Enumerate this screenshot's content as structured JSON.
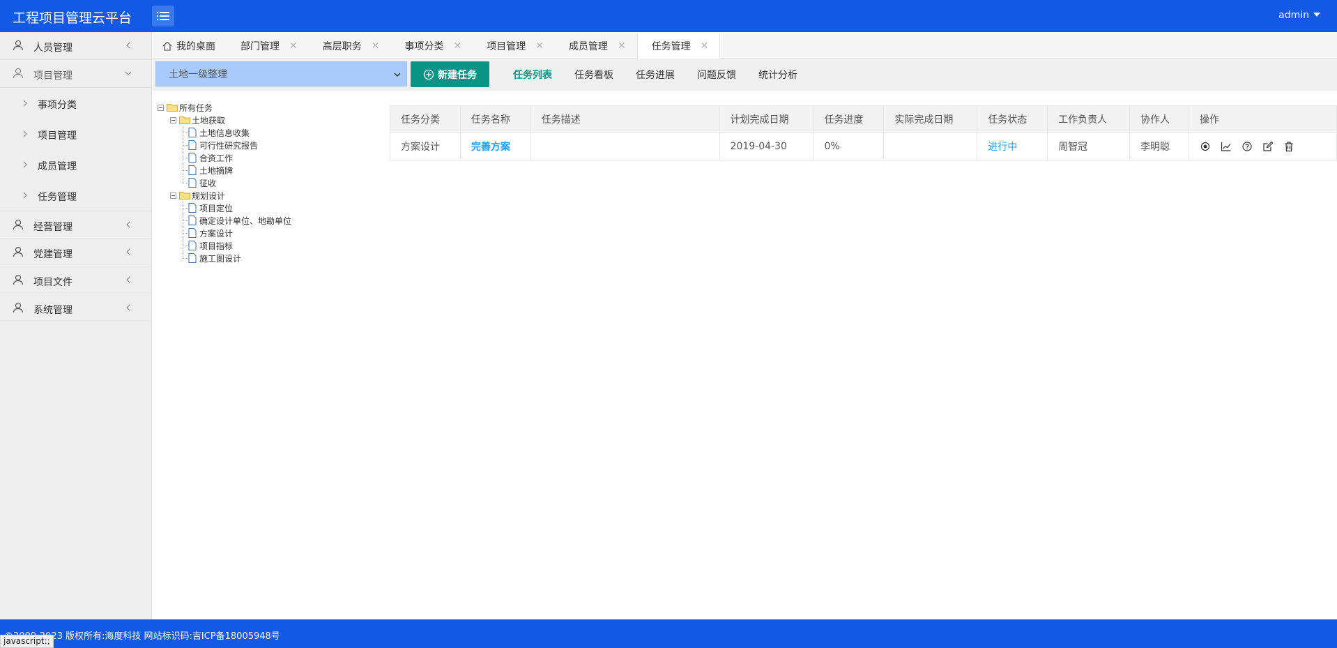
{
  "header": {
    "brand": "工程项目管理云平台",
    "user": "admin"
  },
  "sidebar": {
    "items": [
      {
        "label": "人员管理"
      },
      {
        "label": "项目管理"
      },
      {
        "label": "经营管理"
      },
      {
        "label": "党建管理"
      },
      {
        "label": "项目文件"
      },
      {
        "label": "系统管理"
      }
    ],
    "sub_items": [
      {
        "label": "事项分类"
      },
      {
        "label": "项目管理"
      },
      {
        "label": "成员管理"
      },
      {
        "label": "任务管理"
      }
    ]
  },
  "tabs": [
    {
      "label": "我的桌面"
    },
    {
      "label": "部门管理"
    },
    {
      "label": "高层职务"
    },
    {
      "label": "事项分类"
    },
    {
      "label": "项目管理"
    },
    {
      "label": "成员管理"
    },
    {
      "label": "任务管理"
    }
  ],
  "toolbar": {
    "select_value": "土地一级整理",
    "new_button": "新建任务",
    "subnav": [
      "任务列表",
      "任务看板",
      "任务进展",
      "问题反馈",
      "统计分析"
    ]
  },
  "tree": {
    "root": "所有任务",
    "groups": [
      {
        "label": "土地获取",
        "children": [
          "土地信息收集",
          "可行性研究报告",
          "合资工作",
          "土地摘牌",
          "征收"
        ]
      },
      {
        "label": "规划设计",
        "children": [
          "项目定位",
          "确定设计单位、地勘单位",
          "方案设计",
          "项目指标",
          "施工图设计"
        ]
      }
    ]
  },
  "table": {
    "headers": [
      "任务分类",
      "任务名称",
      "任务描述",
      "计划完成日期",
      "任务进度",
      "实际完成日期",
      "任务状态",
      "工作负责人",
      "协作人",
      "操作"
    ],
    "rows": [
      {
        "category": "方案设计",
        "name": "完善方案",
        "description": "",
        "plan_date": "2019-04-30",
        "progress": "0%",
        "actual_date": "",
        "status": "进行中",
        "owner": "周智冠",
        "collaborator": "李明聪"
      }
    ]
  },
  "footer": {
    "text": "©2009-2023 版权所有:海度科技 网站标识码:吉ICP备18005948号"
  },
  "statusbar": {
    "text": "javascript:;"
  },
  "colors": {
    "primary": "#1159e6",
    "accent_green": "#0a9486",
    "link_blue": "#1e9fff",
    "select_bg": "#a9cbfb"
  }
}
